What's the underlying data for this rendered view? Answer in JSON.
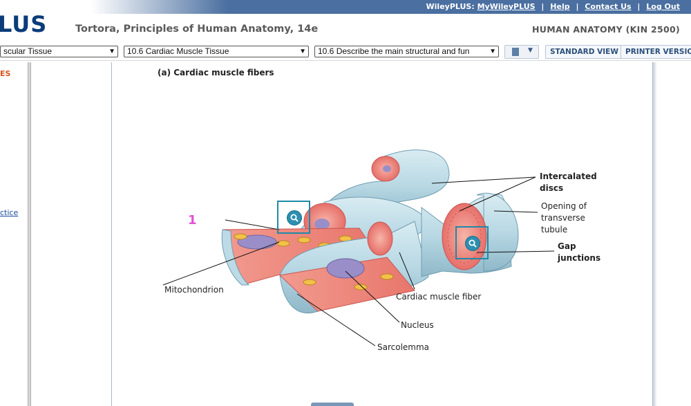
{
  "top_links": {
    "brand": "WileyPLUS:",
    "my": "MyWileyPLUS",
    "help": "Help",
    "contact": "Contact Us",
    "logout": "Log Out"
  },
  "header": {
    "logo": "LUS",
    "book_title": "Tortora, Principles of Human Anatomy, 14e",
    "course_title": "HUMAN ANATOMY (KIN 2500)"
  },
  "nav": {
    "chapter_select": "scular Tissue",
    "section_select": "10.6 Cardiac Muscle Tissue",
    "objective_select": "10.6 Describe the main structural and fun",
    "standard_view": "STANDARD VIEW",
    "printer_version": "PRINTER VERSION"
  },
  "left_nav": {
    "heading": "ES",
    "link": "ctice"
  },
  "figure": {
    "title": "(a) Cardiac muscle fibers",
    "hotspot_number": "1",
    "labels": {
      "intercalated_discs": "Intercalated discs",
      "opening_transverse": "Opening of transverse tubule",
      "gap_junctions": "Gap junctions",
      "mitochondrion": "Mitochondrion",
      "cardiac_fiber": "Cardiac muscle fiber",
      "nucleus": "Nucleus",
      "sarcolemma": "Sarcolemma"
    }
  },
  "colors": {
    "header_blue": "#4a6fa0",
    "logo_blue": "#0b3c7a",
    "accent_orange": "#d9541e",
    "hotspot_teal": "#1e8aa8",
    "number_magenta": "#e64fd6",
    "fiber_blue": "#bcdbe6",
    "fiber_pink": "#f08a8a"
  }
}
